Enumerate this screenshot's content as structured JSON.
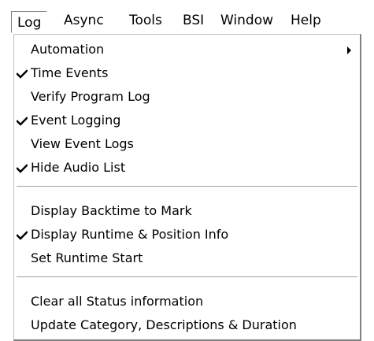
{
  "menubar": {
    "items": [
      {
        "label": "Log",
        "active": true
      },
      {
        "label": "Async"
      },
      {
        "label": "Tools"
      },
      {
        "label": "BSI"
      },
      {
        "label": "Window"
      },
      {
        "label": "Help"
      }
    ]
  },
  "log_menu": {
    "items": [
      {
        "label": "Automation",
        "checked": false,
        "submenu": true
      },
      {
        "label": "Time Events",
        "checked": true
      },
      {
        "label": "Verify Program Log",
        "checked": false
      },
      {
        "label": "Event Logging",
        "checked": true
      },
      {
        "label": "View Event Logs",
        "checked": false
      },
      {
        "label": "Hide Audio List",
        "checked": true
      },
      {
        "label": "Display Backtime to Mark",
        "checked": false
      },
      {
        "label": "Display Runtime & Position Info",
        "checked": true
      },
      {
        "label": "Set Runtime Start",
        "checked": false
      },
      {
        "label": "Clear all Status information",
        "checked": false
      },
      {
        "label": "Update Category, Descriptions & Duration",
        "checked": false
      }
    ]
  },
  "icons": {
    "check": "checkmark-icon",
    "submenu": "submenu-arrow-icon"
  },
  "colors": {
    "background": "#ffffff",
    "text": "#000000",
    "separator": "#a0a0a0",
    "border_dark": "#808080"
  }
}
